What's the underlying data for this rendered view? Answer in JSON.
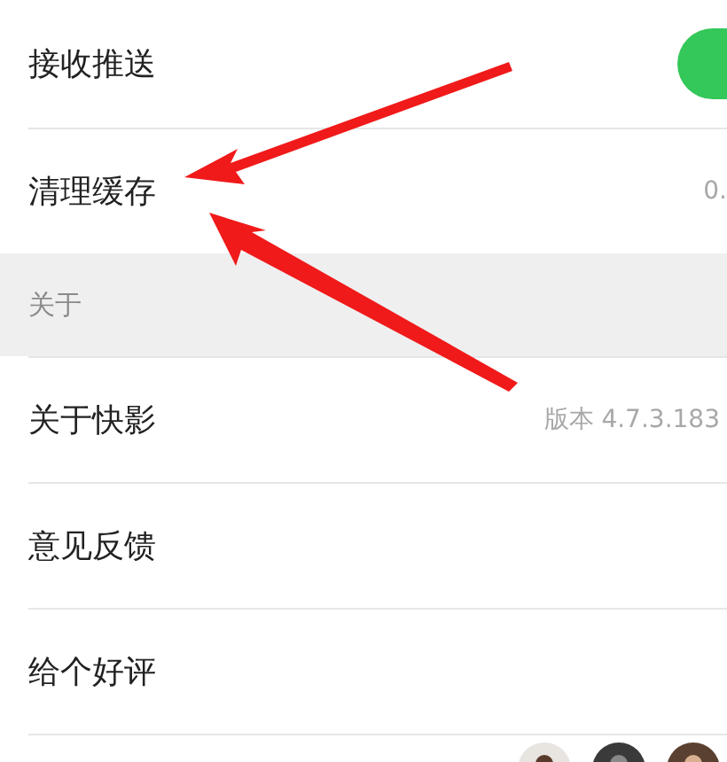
{
  "settings": [
    {
      "kind": "toggle",
      "label": "接收推送",
      "on": true
    },
    {
      "kind": "value",
      "label": "清理缓存",
      "value": "0."
    }
  ],
  "about": {
    "header": "关于",
    "rows": [
      {
        "label": "关于快影",
        "value": "版本 4.7.3.183"
      },
      {
        "label": "意见反馈"
      },
      {
        "label": "给个好评"
      }
    ]
  }
}
